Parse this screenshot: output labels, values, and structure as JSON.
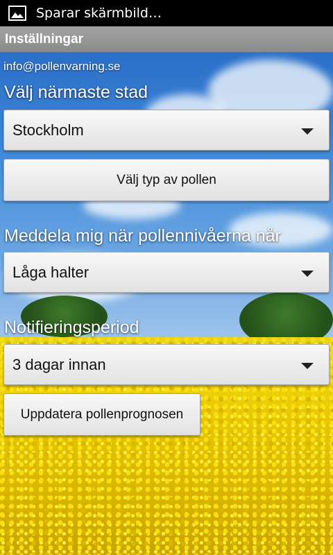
{
  "status_bar": {
    "icon": "image-icon",
    "text": "Sparar skärmbild…"
  },
  "title_bar": {
    "title": "Inställningar"
  },
  "email": "info@pollenvarning.se",
  "city": {
    "label": "Välj närmaste stad",
    "selected": "Stockholm"
  },
  "pollen_type_button": "Välj typ av pollen",
  "notify_level": {
    "label": "Meddela mig när pollennivåerna når",
    "selected": "Låga halter"
  },
  "notify_period": {
    "label": "Notifieringsperiod",
    "selected": "3 dagar innan"
  },
  "update_button": "Uppdatera pollenprognosen"
}
